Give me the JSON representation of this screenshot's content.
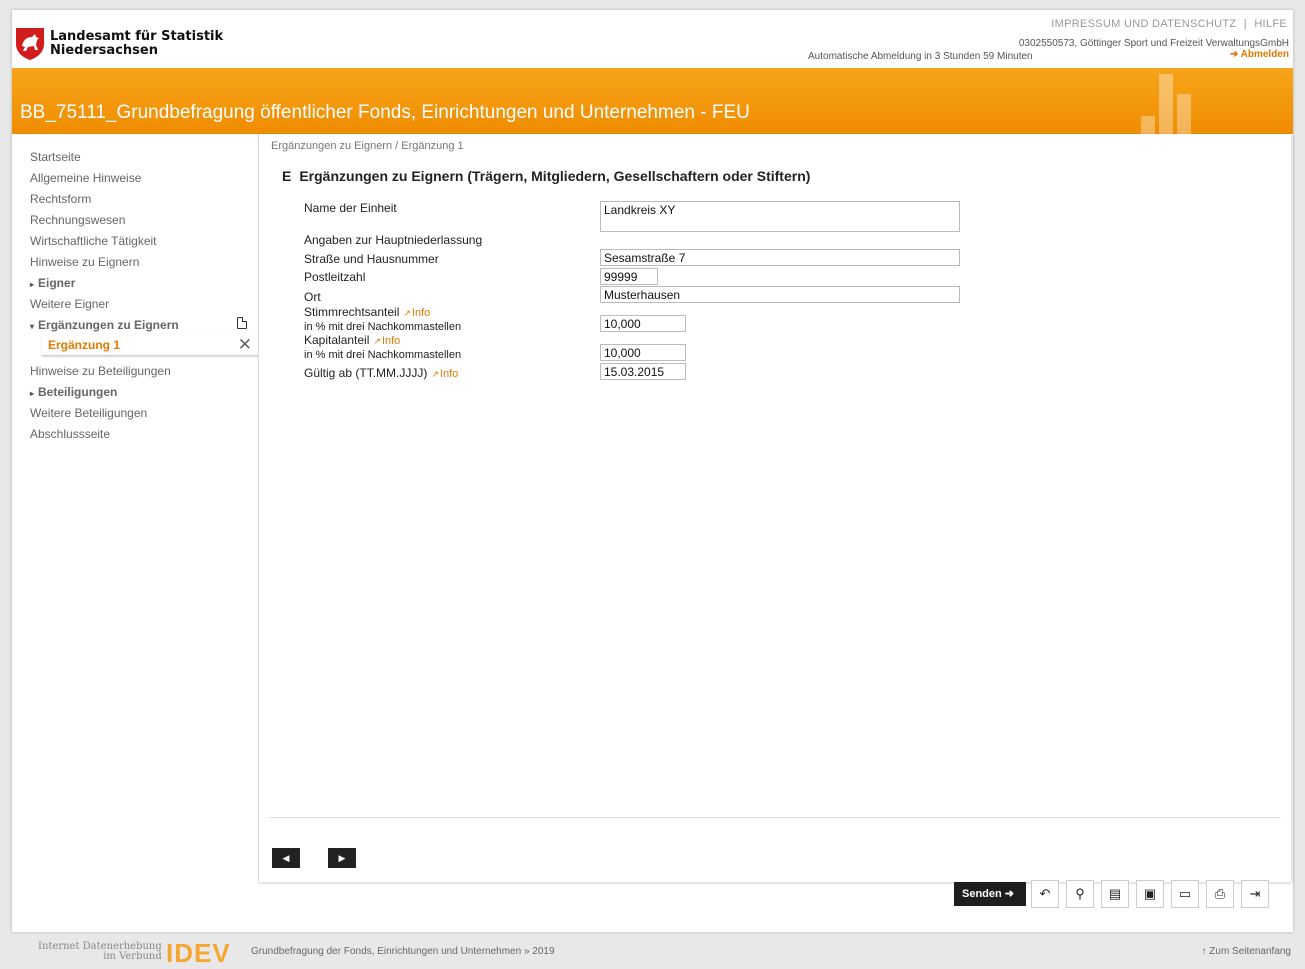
{
  "header": {
    "org_line1": "Landesamt für Statistik",
    "org_line2": "Niedersachsen",
    "link_impressum": "IMPRESSUM UND DATENSCHUTZ",
    "link_separator": "|",
    "link_help": "HILFE",
    "user_info": "0302550573, Göttinger Sport und Freizeit VerwaltungsGmbH",
    "auto_logout": "Automatische Abmeldung in 3 Stunden 59 Minuten",
    "logout": "➜ Abmelden"
  },
  "banner": {
    "title": "BB_75111_Grundbefragung öffentlicher Fonds, Einrichtungen und Unternehmen - FEU"
  },
  "sidebar": {
    "items": [
      {
        "label": "Startseite"
      },
      {
        "label": "Allgemeine Hinweise"
      },
      {
        "label": "Rechtsform"
      },
      {
        "label": "Rechnungswesen"
      },
      {
        "label": "Wirtschaftliche Tätigkeit"
      },
      {
        "label": "Hinweise zu Eignern"
      },
      {
        "label": "Eigner",
        "caret": "▸"
      },
      {
        "label": "Weitere Eigner"
      },
      {
        "label": "Ergänzungen zu Eignern",
        "caret": "▾"
      },
      {
        "label": "Ergänzung 1"
      },
      {
        "label": "Hinweise zu Beteiligungen"
      },
      {
        "label": "Beteiligungen",
        "caret": "▸"
      },
      {
        "label": "Weitere Beteiligungen"
      },
      {
        "label": "Abschlussseite"
      }
    ],
    "close_symbol": "✕"
  },
  "main": {
    "breadcrumb": "Ergänzungen zu Eignern / Ergänzung 1",
    "section_letter": "E",
    "section_title": "Ergänzungen zu Eignern (Trägern, Mitgliedern, Gesellschaftern oder Stiftern)",
    "info_label": "Info",
    "fields": {
      "name_label": "Name der Einheit",
      "name_value": "Landkreis XY",
      "hq_label": "Angaben zur Hauptniederlassung",
      "street_label": "Straße und Hausnummer",
      "street_value": "Sesamstraße 7",
      "zip_label": "Postleitzahl",
      "zip_value": "99999",
      "city_label": "Ort",
      "city_value": "Musterhausen",
      "voting_label": "Stimmrechtsanteil",
      "voting_sub": "in % mit drei Nachkommastellen",
      "voting_value": "10,000",
      "capital_label": "Kapitalanteil",
      "capital_sub": "in % mit drei Nachkommastellen",
      "capital_value": "10,000",
      "valid_label": "Gültig ab (TT.MM.JJJJ)",
      "valid_value": "15.03.2015"
    },
    "prev_symbol": "◀",
    "next_symbol": "▶"
  },
  "toolbar": {
    "send_label": "Senden ➜",
    "undo": "↶",
    "search": "⚲",
    "pdf": "▤",
    "save": "▣",
    "open": "▭",
    "print": "⎙",
    "exit": "⇥"
  },
  "footer": {
    "idev_line1": "Internet Datenerhebung",
    "idev_line2": "im Verbund",
    "idev_logo": "IDEV",
    "survey": "Grundbefragung der Fonds, Einrichtungen und Unternehmen » 2019",
    "to_top": "↑ Zum Seitenanfang"
  }
}
